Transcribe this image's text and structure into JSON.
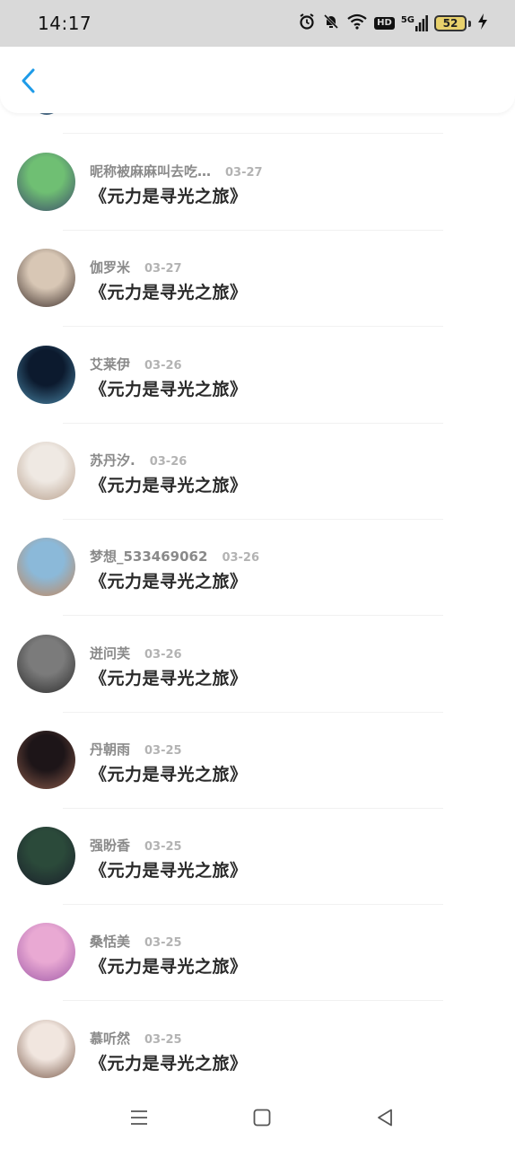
{
  "status_bar": {
    "time": "14:17",
    "network": "5G",
    "hd": "HD",
    "battery": "52"
  },
  "header": {
    "back_icon": "chevron-left-icon",
    "accent_color": "#1e9be8"
  },
  "comments": [
    {
      "name": "昵称被麻麻叫去吃…",
      "date": "03-27",
      "text": "《元力是寻光之旅》",
      "avatar_colors": [
        "#6fbf73",
        "#3b4a6b"
      ]
    },
    {
      "name": "伽罗米",
      "date": "03-27",
      "text": "《元力是寻光之旅》",
      "avatar_colors": [
        "#d8c7b5",
        "#3a2c28"
      ]
    },
    {
      "name": "艾莱伊",
      "date": "03-26",
      "text": "《元力是寻光之旅》",
      "avatar_colors": [
        "#0c1a2e",
        "#4a86a6"
      ]
    },
    {
      "name": "苏丹汐.",
      "date": "03-26",
      "text": "《元力是寻光之旅》",
      "avatar_colors": [
        "#efe9e3",
        "#b79f8c"
      ]
    },
    {
      "name": "梦想_533469062",
      "date": "03-26",
      "text": "《元力是寻光之旅》",
      "avatar_colors": [
        "#8bb9d9",
        "#c4865a"
      ]
    },
    {
      "name": "迸问芙",
      "date": "03-26",
      "text": "《元力是寻光之旅》",
      "avatar_colors": [
        "#7b7b7b",
        "#2c2c2c"
      ]
    },
    {
      "name": "丹朝雨",
      "date": "03-25",
      "text": "《元力是寻光之旅》",
      "avatar_colors": [
        "#1d1518",
        "#8a5a4a"
      ]
    },
    {
      "name": "强盼香",
      "date": "03-25",
      "text": "《元力是寻光之旅》",
      "avatar_colors": [
        "#2b4a3a",
        "#1a1f2b"
      ]
    },
    {
      "name": "桑恬美",
      "date": "03-25",
      "text": "《元力是寻光之旅》",
      "avatar_colors": [
        "#e9a9d3",
        "#a05aa8"
      ]
    },
    {
      "name": "慕听然",
      "date": "03-25",
      "text": "《元力是寻光之旅》",
      "avatar_colors": [
        "#f1e6df",
        "#7a5a4a"
      ]
    }
  ],
  "nav_bar": {
    "menu_icon": "menu-icon",
    "home_icon": "home-square-icon",
    "back_icon": "back-triangle-icon"
  }
}
